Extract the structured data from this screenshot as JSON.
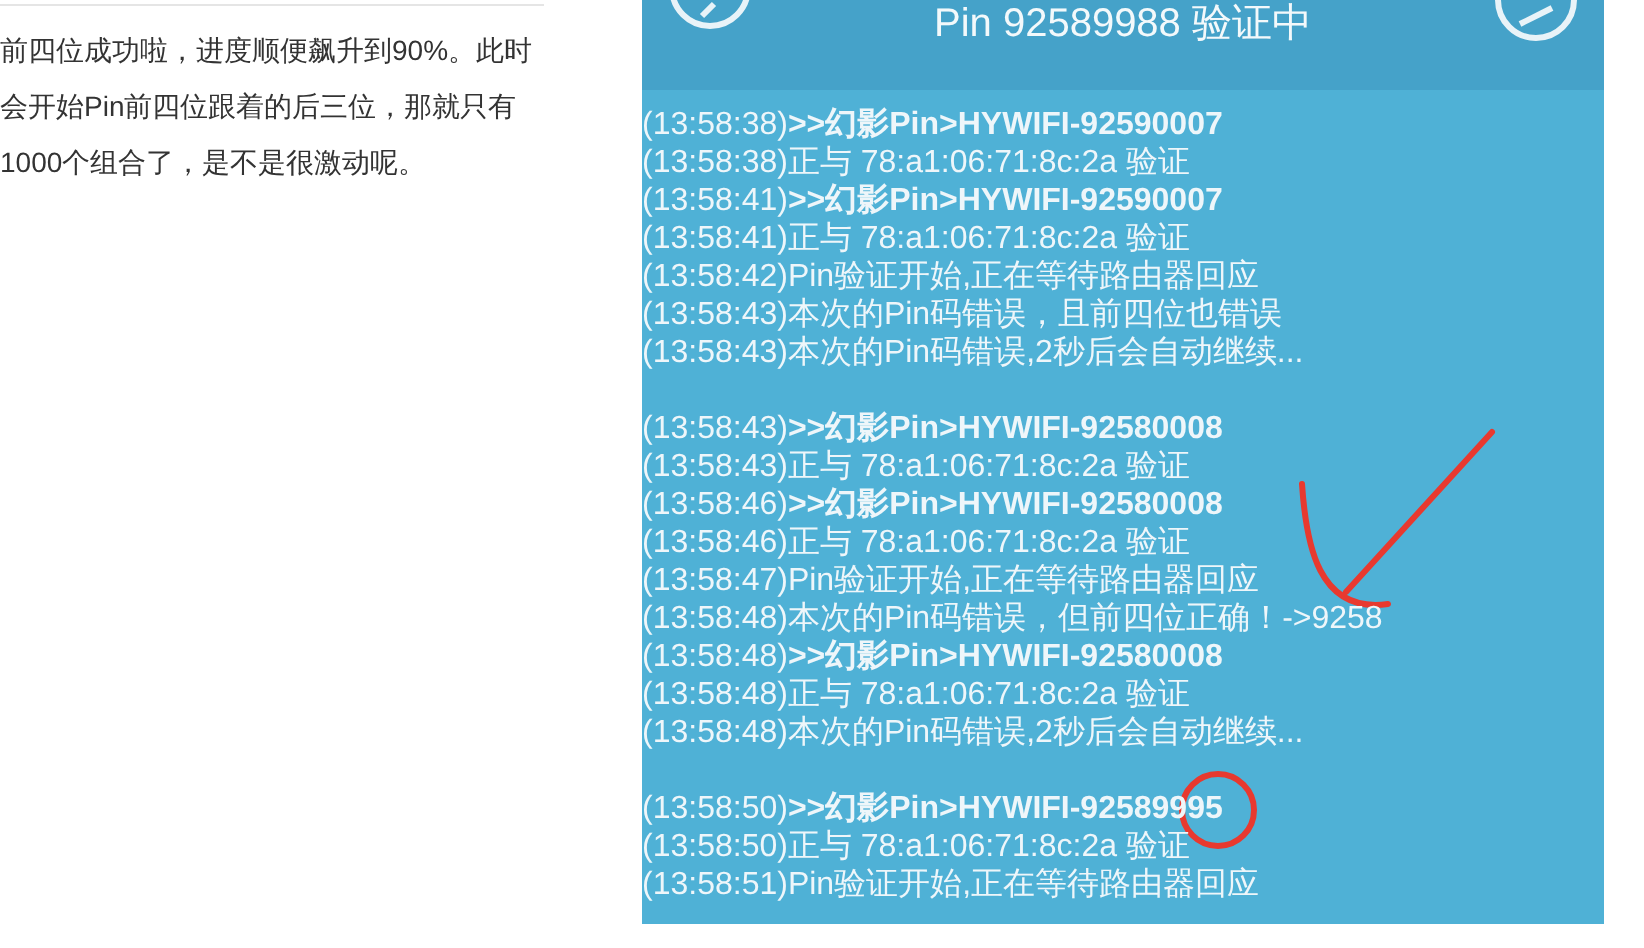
{
  "article": {
    "paragraph": "前四位成功啦，进度顺便飙升到90%。此时会开始Pin前四位跟着的后三位，那就只有1000个组合了，是不是很激动呢。"
  },
  "app_screenshot": {
    "title": "Pin 92589988 验证中",
    "log_groups": [
      {
        "lines": [
          {
            "time": "(13:58:38)",
            "text": ">>幻影Pin>HYWIFI-92590007",
            "kind": "bold"
          },
          {
            "time": "(13:58:38)",
            "text": "正与 78:a1:06:71:8c:2a 验证",
            "kind": "normal"
          },
          {
            "time": "(13:58:41)",
            "text": ">>幻影Pin>HYWIFI-92590007",
            "kind": "bold"
          },
          {
            "time": "(13:58:41)",
            "text": "正与 78:a1:06:71:8c:2a 验证",
            "kind": "normal"
          },
          {
            "time": "(13:58:42)",
            "text": "Pin验证开始,正在等待路由器回应",
            "kind": "normal"
          },
          {
            "time": "(13:58:43)",
            "text": "本次的Pin码错误，且前四位也错误",
            "kind": "normal"
          },
          {
            "time": "(13:58:43)",
            "text": "本次的Pin码错误,2秒后会自动继续...",
            "kind": "normal"
          }
        ]
      },
      {
        "lines": [
          {
            "time": "(13:58:43)",
            "text": ">>幻影Pin>HYWIFI-92580008",
            "kind": "bold"
          },
          {
            "time": "(13:58:43)",
            "text": "正与 78:a1:06:71:8c:2a 验证",
            "kind": "normal"
          },
          {
            "time": "(13:58:46)",
            "text": ">>幻影Pin>HYWIFI-92580008",
            "kind": "bold"
          },
          {
            "time": "(13:58:46)",
            "text": "正与 78:a1:06:71:8c:2a 验证",
            "kind": "normal"
          },
          {
            "time": "(13:58:47)",
            "text": "Pin验证开始,正在等待路由器回应",
            "kind": "normal"
          },
          {
            "time": "(13:58:48)",
            "text": "本次的Pin码错误，但前四位正确！->9258",
            "kind": "normal"
          },
          {
            "time": "(13:58:48)",
            "text": ">>幻影Pin>HYWIFI-92580008",
            "kind": "bold"
          },
          {
            "time": "(13:58:48)",
            "text": "正与 78:a1:06:71:8c:2a 验证",
            "kind": "normal"
          },
          {
            "time": "(13:58:48)",
            "text": "本次的Pin码错误,2秒后会自动继续...",
            "kind": "normal"
          }
        ]
      },
      {
        "lines": [
          {
            "time": "(13:58:50)",
            "text": ">>幻影Pin>HYWIFI-92589995",
            "kind": "bold"
          },
          {
            "time": "(13:58:50)",
            "text": "正与 78:a1:06:71:8c:2a 验证",
            "kind": "normal"
          },
          {
            "time": "(13:58:51)",
            "text": "Pin验证开始,正在等待路由器回应",
            "kind": "normal"
          }
        ]
      }
    ]
  }
}
